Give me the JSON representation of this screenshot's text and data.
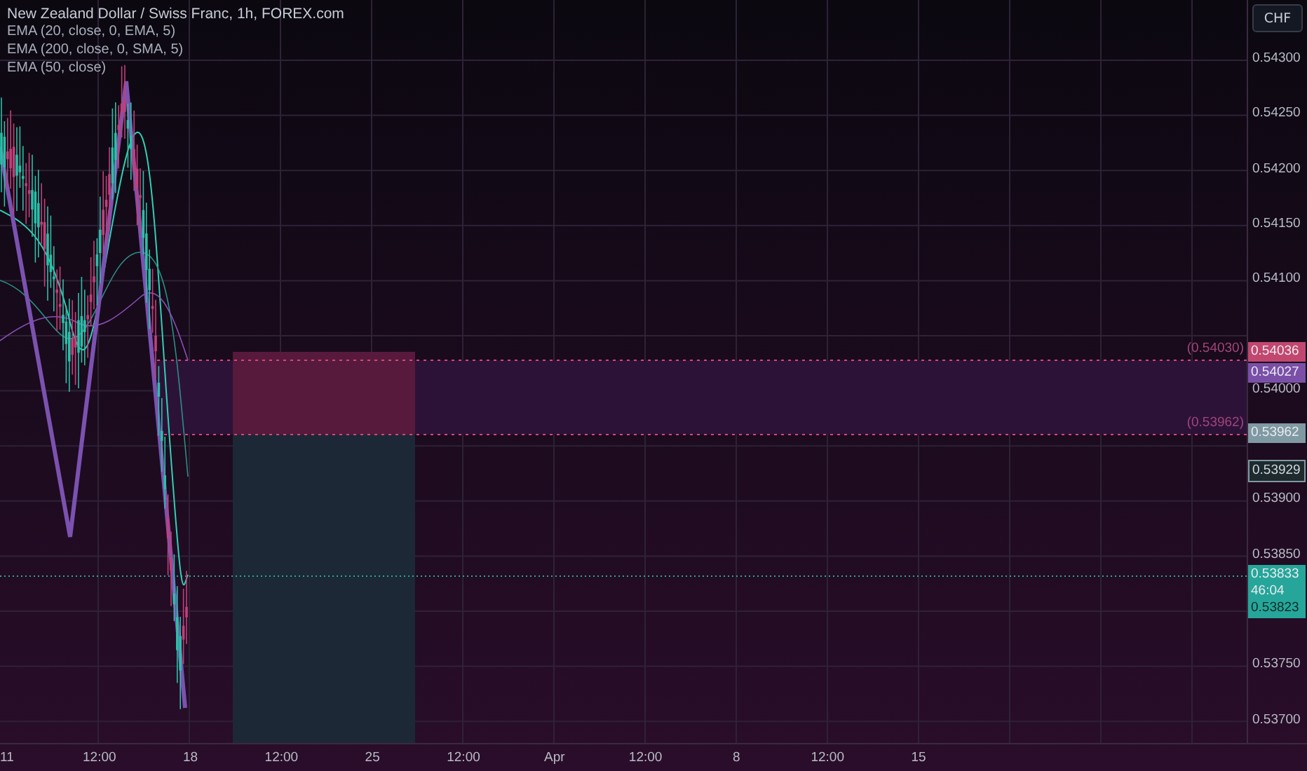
{
  "legend": {
    "title": "New Zealand Dollar / Swiss Franc, 1h, FOREX.com",
    "indicators": [
      "EMA (20, close, 0, EMA, 5)",
      "EMA (200, close, 0, SMA, 5)",
      "EMA (50, close)"
    ]
  },
  "currency_button": "CHF",
  "price_axis": [
    "0.54300",
    "0.54250",
    "0.54200",
    "0.54150",
    "0.54100",
    "0.54000",
    "0.53900",
    "0.53850",
    "0.53750",
    "0.53700"
  ],
  "price_tags": [
    {
      "kind": "stop",
      "text": "0.54036"
    },
    {
      "kind": "entry",
      "text": "0.54027"
    },
    {
      "kind": "target",
      "text": "0.53962"
    },
    {
      "kind": "outlined",
      "text": "0.53929"
    },
    {
      "kind": "live",
      "text": "0.53833",
      "countdown": "46:04",
      "low": "0.53823"
    }
  ],
  "line_labels": [
    "(0.54030)",
    "(0.53962)"
  ],
  "time_axis": [
    "11",
    "12:00",
    "18",
    "12:00",
    "25",
    "12:00",
    "Apr",
    "12:00",
    "8",
    "12:00",
    "15"
  ]
}
